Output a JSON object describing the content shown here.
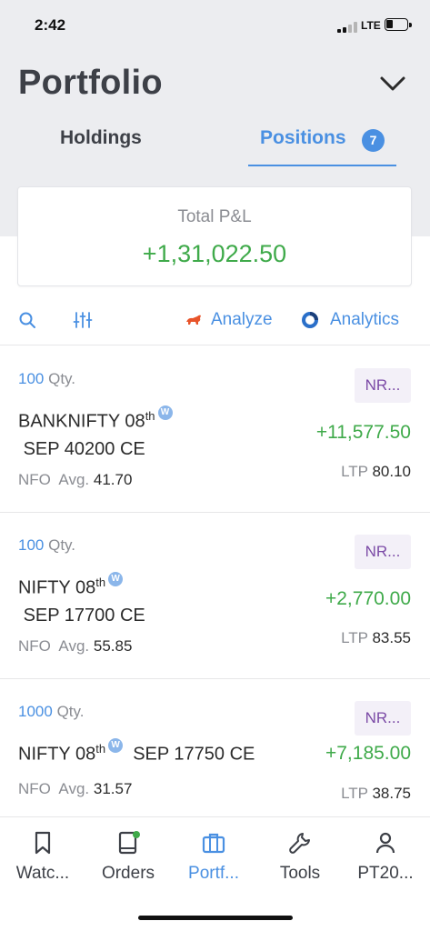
{
  "status_bar": {
    "time": "2:42",
    "network": "LTE"
  },
  "header": {
    "title": "Portfolio",
    "dropdown_icon": "chevron-down-icon"
  },
  "tabs": [
    {
      "label": "Holdings",
      "active": false
    },
    {
      "label": "Positions",
      "active": true,
      "badge": "7"
    }
  ],
  "summary": {
    "label": "Total P&L",
    "value": "+1,31,022.50"
  },
  "toolbar": {
    "search_icon": "search-icon",
    "filter_icon": "filter-sliders-icon",
    "analyze_label": "Analyze",
    "analytics_label": "Analytics"
  },
  "positions": [
    {
      "qty": "100",
      "qty_unit": "Qty.",
      "symbol_part1": "BANKNIFTY 08",
      "symbol_sup": "th",
      "symbol_part2": "SEP 40200 CE",
      "weekly": "W",
      "exchange": "NFO",
      "avg_label": "Avg.",
      "avg": "41.70",
      "product": "NR...",
      "pnl": "+11,577.50",
      "ltp_label": "LTP",
      "ltp": "80.10"
    },
    {
      "qty": "100",
      "qty_unit": "Qty.",
      "symbol_part1": "NIFTY 08",
      "symbol_sup": "th",
      "symbol_part2": "SEP 17700 CE",
      "weekly": "W",
      "exchange": "NFO",
      "avg_label": "Avg.",
      "avg": "55.85",
      "product": "NR...",
      "pnl": "+2,770.00",
      "ltp_label": "LTP",
      "ltp": "83.55"
    },
    {
      "qty": "1000",
      "qty_unit": "Qty.",
      "symbol_part1": "NIFTY 08",
      "symbol_sup": "th",
      "symbol_part2": "SEP 17750 CE",
      "weekly": "W",
      "exchange": "NFO",
      "avg_label": "Avg.",
      "avg": "31.57",
      "product": "NR...",
      "pnl": "+7,185.00",
      "ltp_label": "LTP",
      "ltp": "38.75"
    }
  ],
  "bottom_nav": [
    {
      "label": "Watc...",
      "icon": "bookmark-icon"
    },
    {
      "label": "Orders",
      "icon": "orders-book-icon"
    },
    {
      "label": "Portf...",
      "icon": "briefcase-icon"
    },
    {
      "label": "Tools",
      "icon": "wrench-icon"
    },
    {
      "label": "PT20...",
      "icon": "user-icon"
    }
  ],
  "colors": {
    "accent": "#4a90e2",
    "profit": "#3faa4a",
    "product_badge_text": "#7b4aa6",
    "header_bg": "#ecedf0"
  }
}
